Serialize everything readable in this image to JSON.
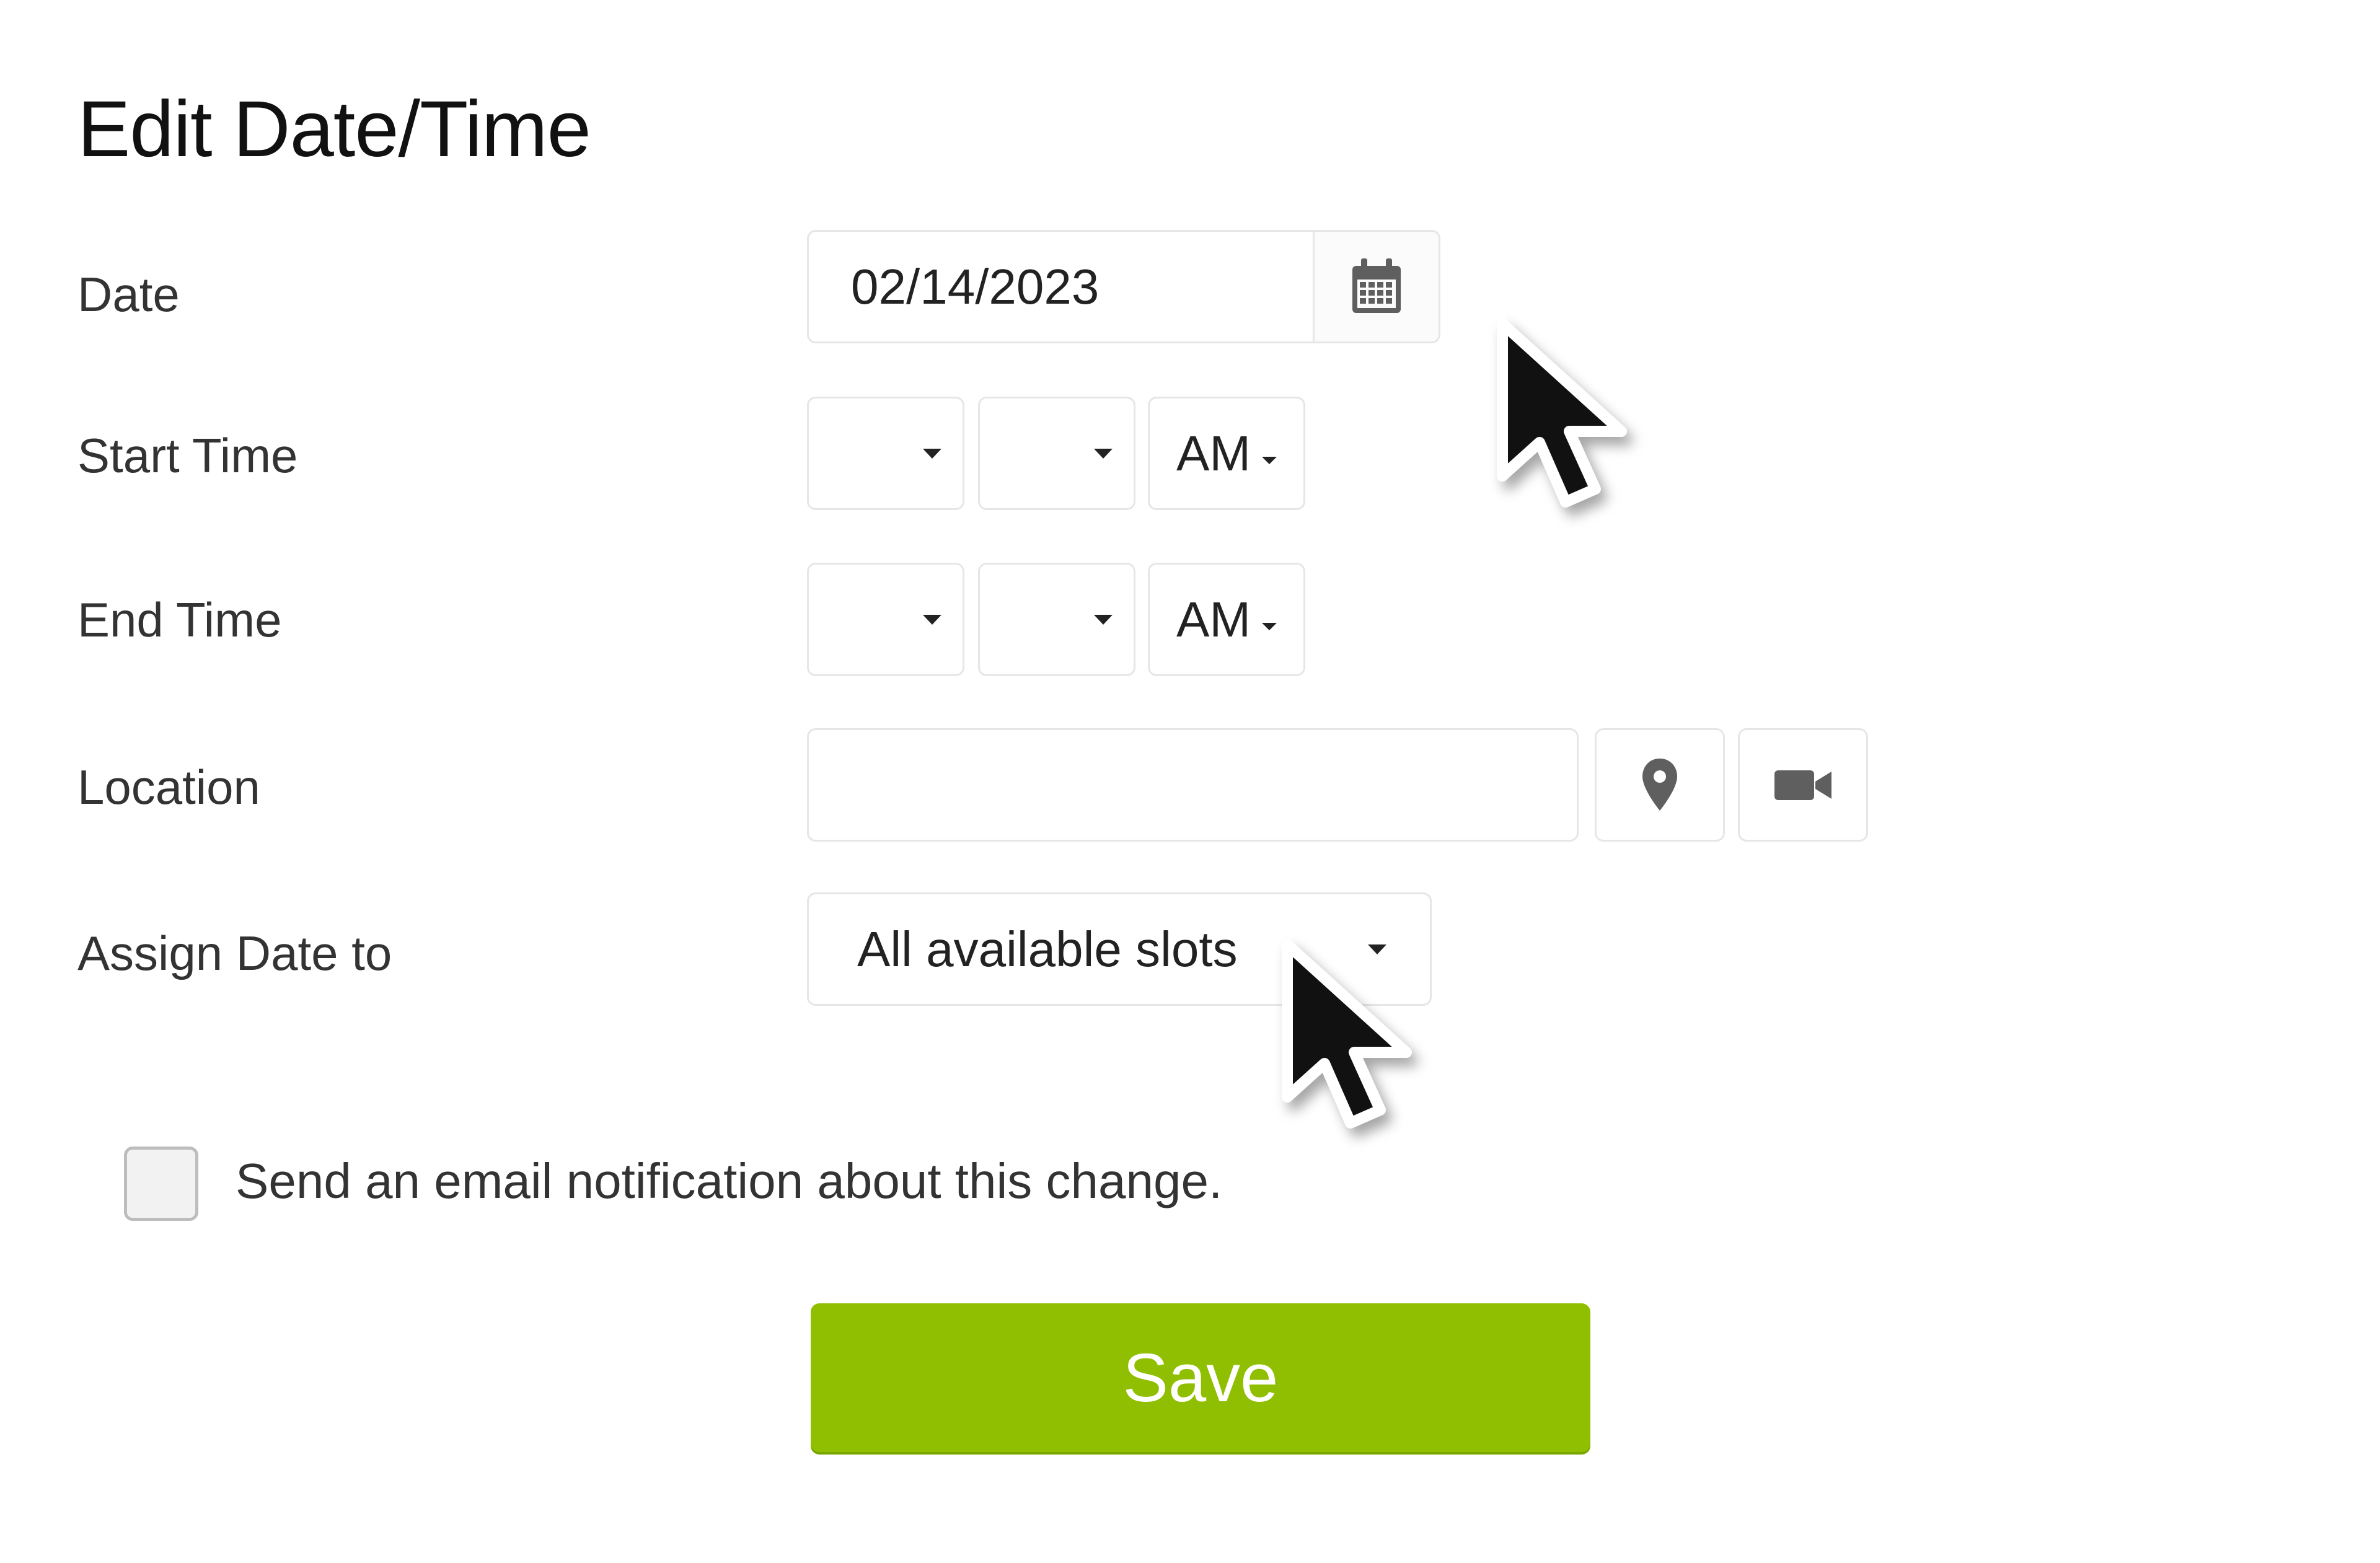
{
  "dialog": {
    "title": "Edit Date/Time"
  },
  "form": {
    "date": {
      "label": "Date",
      "value": "02/14/2023",
      "calendar_icon": "calendar-icon"
    },
    "start_time": {
      "label": "Start Time",
      "hour": "",
      "minute": "",
      "meridiem": "AM"
    },
    "end_time": {
      "label": "End Time",
      "hour": "",
      "minute": "",
      "meridiem": "AM"
    },
    "location": {
      "label": "Location",
      "value": "",
      "pin_icon": "map-pin-icon",
      "video_icon": "video-camera-icon"
    },
    "assign": {
      "label": "Assign Date to",
      "selected": "All available slots"
    },
    "notify": {
      "label": "Send an email notification about this change.",
      "checked": false
    },
    "save_label": "Save"
  },
  "colors": {
    "accent": "#8fbf00",
    "border": "#e6e6e6",
    "text": "#222222"
  }
}
